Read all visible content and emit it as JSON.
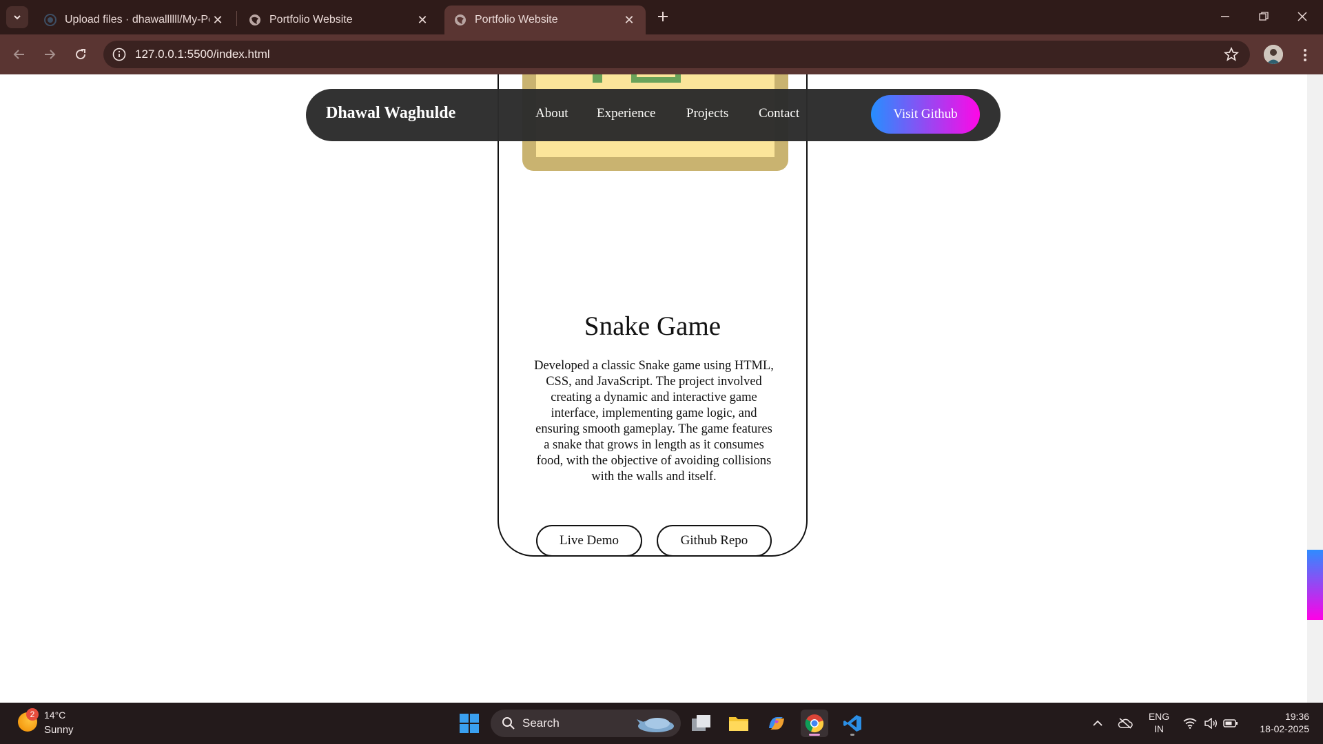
{
  "browser": {
    "tabs": [
      {
        "title": "Upload files · dhawallllll/My-Por",
        "active": false,
        "favicon": "github-icon"
      },
      {
        "title": "Portfolio Website",
        "active": false,
        "favicon": "globe-icon"
      },
      {
        "title": "Portfolio Website",
        "active": true,
        "favicon": "globe-icon"
      }
    ],
    "url": "127.0.0.1:5500/index.html",
    "accent": "#5a3532",
    "frame_color": "#2f1b19"
  },
  "navbar": {
    "brand": "Dhawal Waghulde",
    "links": [
      "About",
      "Experience",
      "Projects",
      "Contact"
    ],
    "cta": "Visit Github",
    "cta_gradient": [
      "#1f8bff",
      "#ff00e6"
    ]
  },
  "project_card": {
    "title": "Snake Game",
    "description": "Developed a classic Snake game using HTML, CSS, and JavaScript. The project involved creating a dynamic and interactive game interface, implementing game logic, and ensuring smooth gameplay. The game features a snake that grows in length as it consumes food, with the objective of avoiding collisions with the walls and itself.",
    "buttons": [
      "Live Demo",
      "Github Repo"
    ],
    "preview_colors": {
      "frame": "#c9b370",
      "board": "#fbe59a",
      "snake": "#6aa35a"
    }
  },
  "taskbar": {
    "weather": {
      "badge": "2",
      "temp": "14°C",
      "condition": "Sunny"
    },
    "search_label": "Search",
    "language": {
      "line1": "ENG",
      "line2": "IN"
    },
    "time": "19:36",
    "date": "18-02-2025"
  }
}
